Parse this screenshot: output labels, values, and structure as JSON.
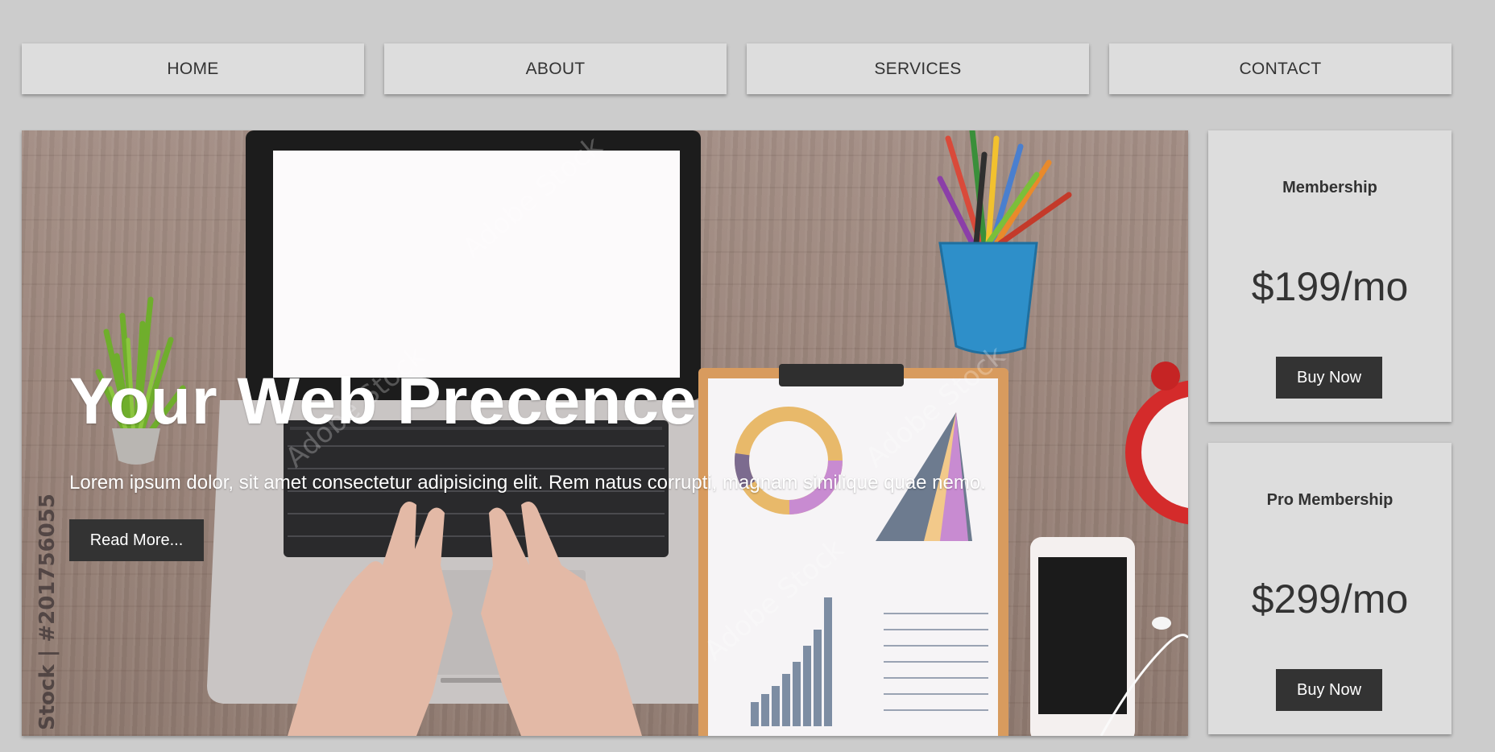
{
  "nav": {
    "items": [
      {
        "label": "HOME"
      },
      {
        "label": "ABOUT"
      },
      {
        "label": "SERVICES"
      },
      {
        "label": "CONTACT"
      }
    ]
  },
  "hero": {
    "title": "Your Web Precence",
    "text": "Lorem ipsum dolor, sit amet consectetur adipisicing elit. Rem natus corrupti, magnam similique quae nemo.",
    "button_label": "Read More...",
    "watermark": "Stock | #201756055",
    "watermark_brand": "Adobe Stock"
  },
  "pricing": [
    {
      "name": "Membership",
      "price": "$199/mo",
      "button_label": "Buy Now"
    },
    {
      "name": "Pro Membership",
      "price": "$299/mo",
      "button_label": "Buy Now"
    }
  ],
  "colors": {
    "background": "#cccccc",
    "panel": "#dddddd",
    "button": "#333333",
    "text": "#333333"
  }
}
